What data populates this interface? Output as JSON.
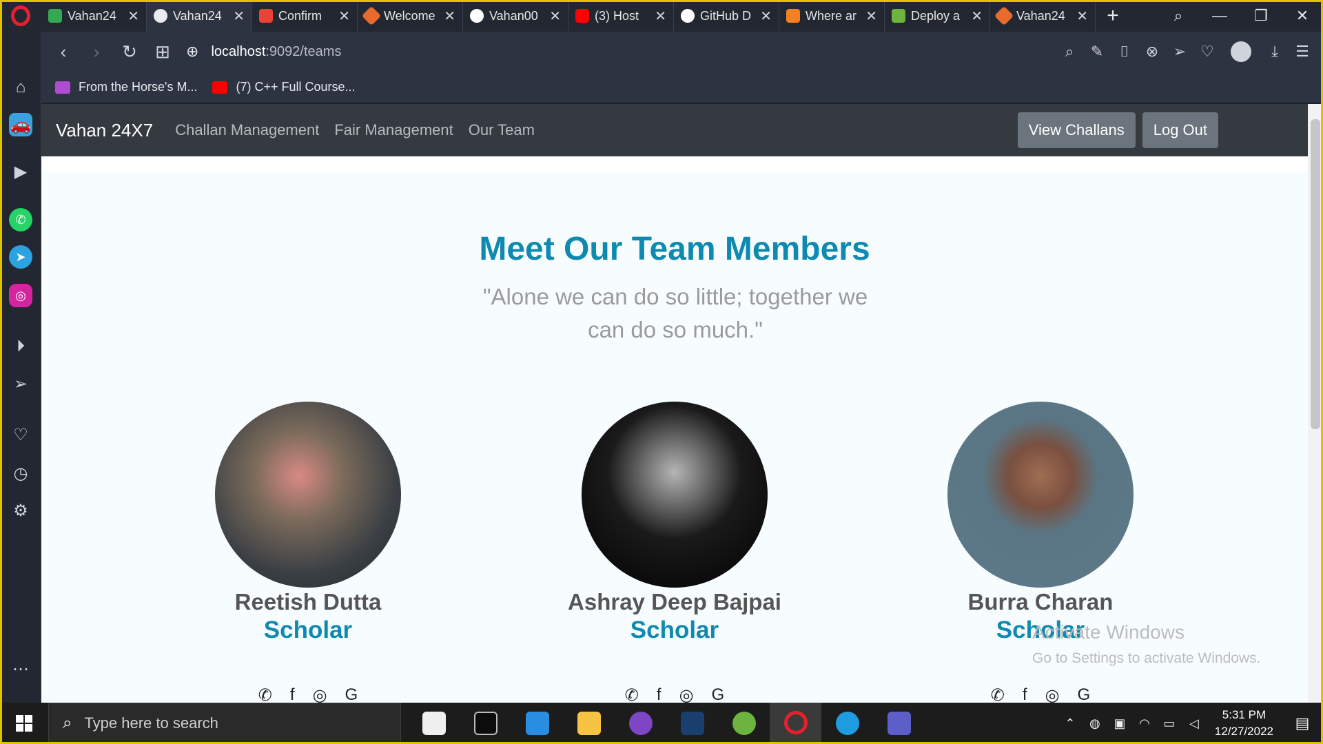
{
  "browser": {
    "tabs": [
      {
        "label": "Vahan24",
        "color": "#34a853"
      },
      {
        "label": "Vahan24",
        "color": "#e9ebf0",
        "active": true
      },
      {
        "label": "Confirm",
        "color": "#ea4335"
      },
      {
        "label": "Welcome",
        "color": "#e86a2c"
      },
      {
        "label": "Vahan00",
        "color": "#ffffff"
      },
      {
        "label": "(3) Host",
        "color": "#ff0000"
      },
      {
        "label": "GitHub D",
        "color": "#ffffff"
      },
      {
        "label": "Where ar",
        "color": "#f48024"
      },
      {
        "label": "Deploy a",
        "color": "#6db33f"
      },
      {
        "label": "Vahan24",
        "color": "#e86a2c"
      }
    ],
    "url_host": "localhost",
    "url_path": ":9092/teams",
    "bookmarks": [
      {
        "label": "From the Horse's M...",
        "color": "#b04bd3"
      },
      {
        "label": "(7) C++ Full Course...",
        "color": "#ff0000"
      }
    ]
  },
  "site": {
    "brand": "Vahan 24X7",
    "nav": [
      "Challan Management",
      "Fair Management",
      "Our Team"
    ],
    "buttons": {
      "view_challans": "View Challans",
      "logout": "Log Out"
    },
    "title": "Meet Our Team Members",
    "quote": "\"Alone we can do so little; together we can do so much.\"",
    "members": [
      {
        "name": "Reetish Dutta",
        "role": "Scholar"
      },
      {
        "name": "Ashray Deep Bajpai",
        "role": "Scholar"
      },
      {
        "name": "Burra Charan",
        "role": "Scholar"
      }
    ]
  },
  "watermark": {
    "line1": "Activate Windows",
    "line2": "Go to Settings to activate Windows."
  },
  "taskbar": {
    "search_placeholder": "Type here to search",
    "time": "5:31 PM",
    "date": "12/27/2022"
  }
}
